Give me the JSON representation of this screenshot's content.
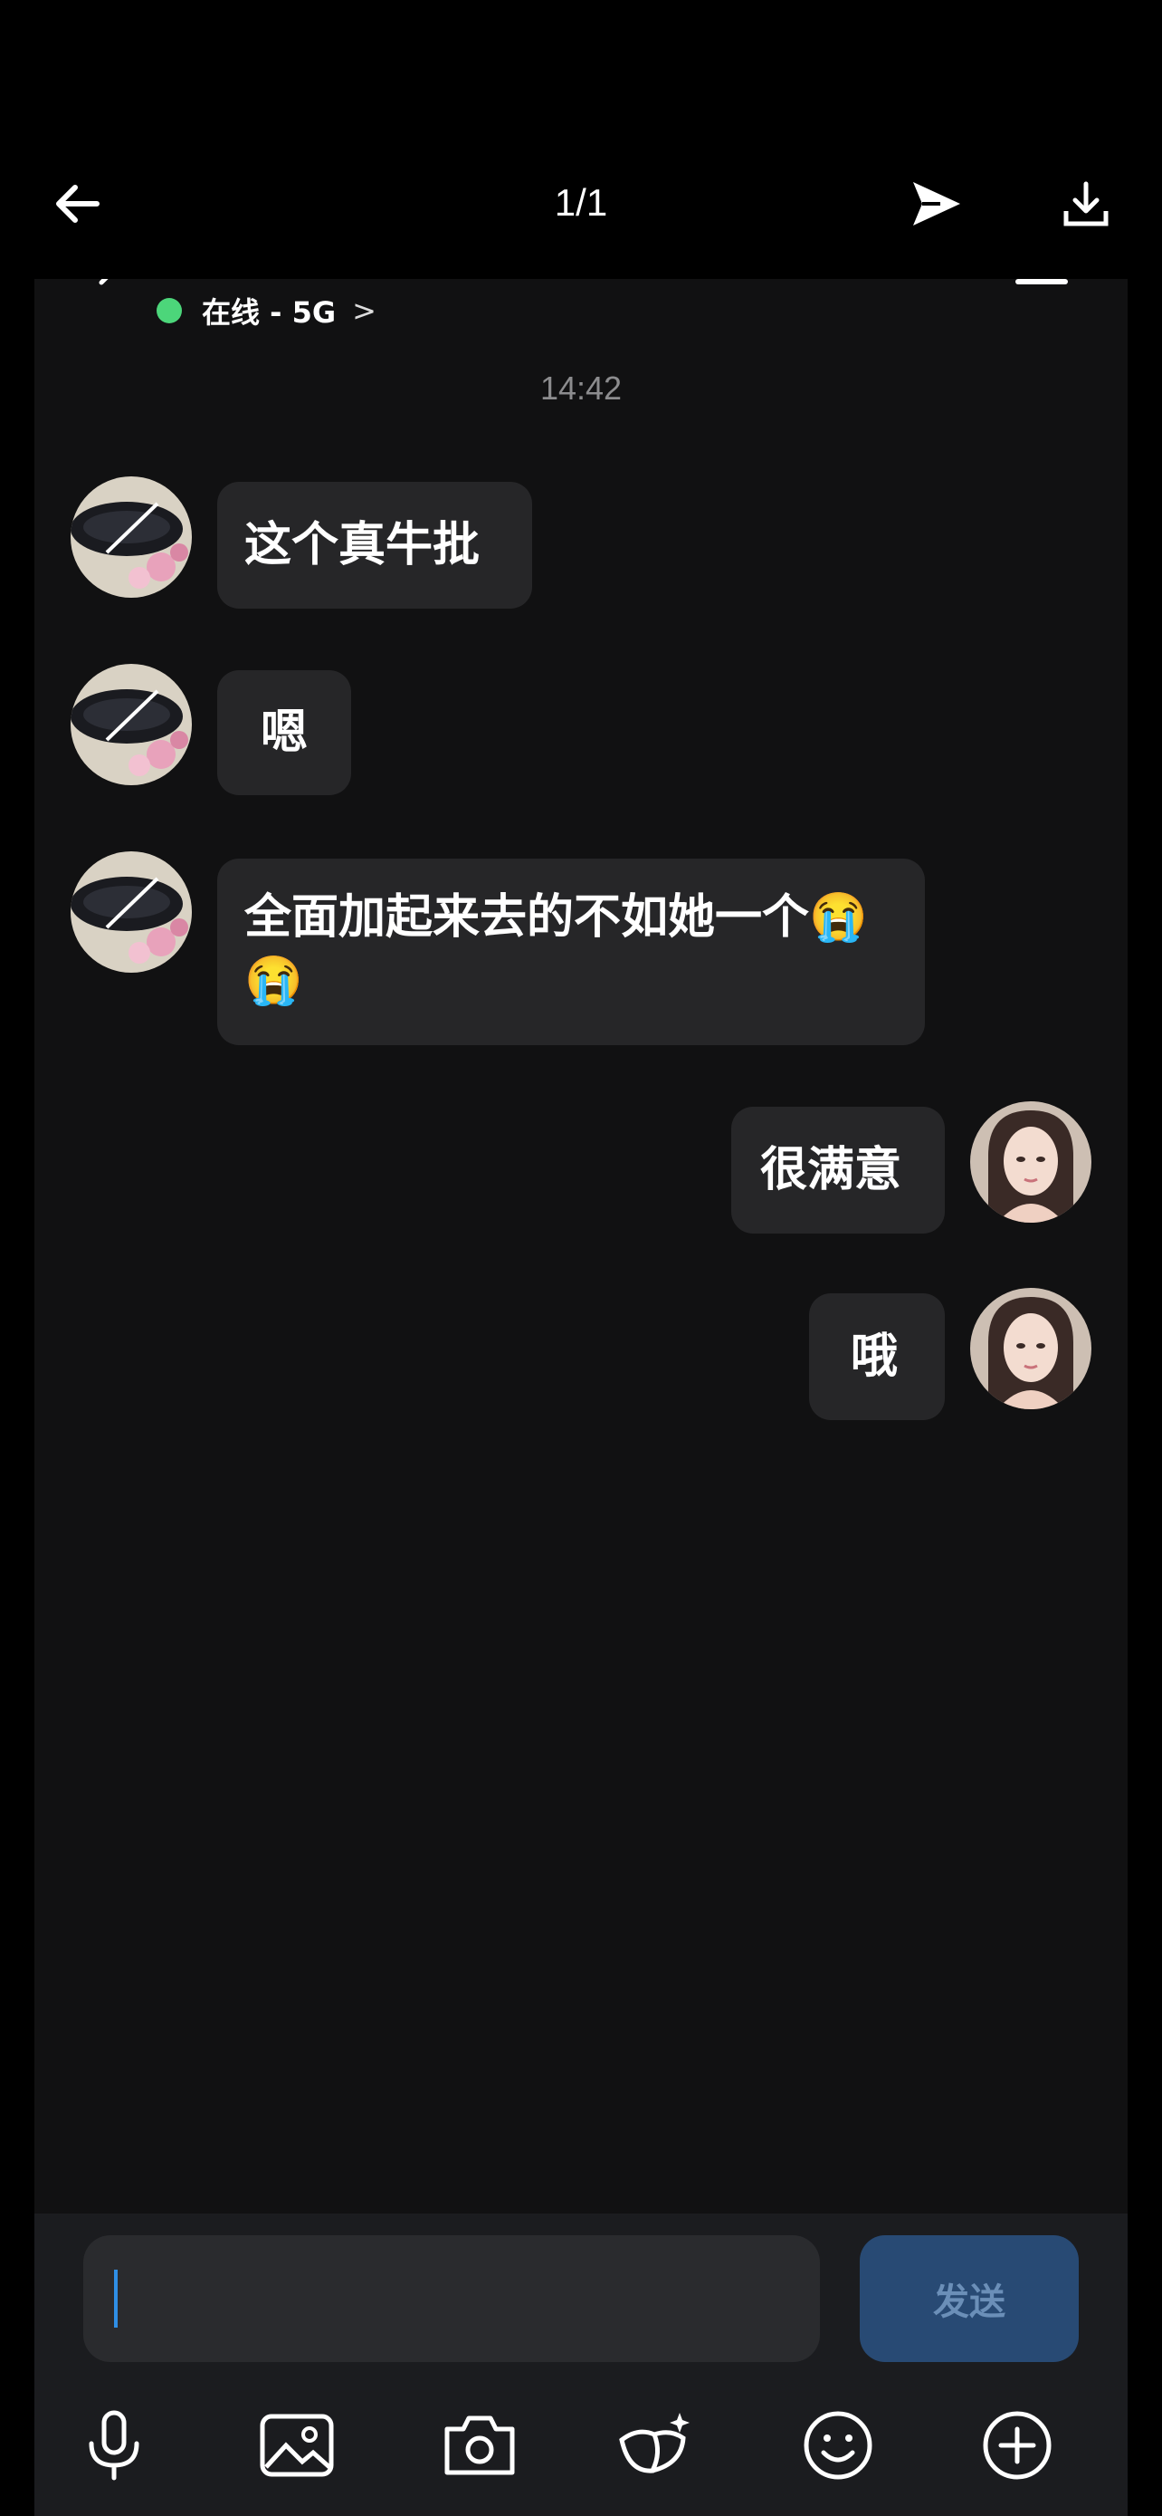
{
  "viewer": {
    "counter": "1/1",
    "icons": [
      "back-arrow-icon",
      "send-icon",
      "download-icon"
    ]
  },
  "chat": {
    "status": "在线 - 5G",
    "status_chevron": ">",
    "status_color": "#4cd67a",
    "timestamp": "14:42",
    "messages": [
      {
        "side": "left",
        "text": "这个真牛批"
      },
      {
        "side": "left",
        "text": "嗯"
      },
      {
        "side": "left",
        "text": "全面加起来去的不如她一个😭😭"
      },
      {
        "side": "right",
        "text": "很满意"
      },
      {
        "side": "right",
        "text": "哦"
      }
    ],
    "input": {
      "value": ""
    },
    "send_label": "发送",
    "toolbar": [
      "microphone-icon",
      "image-icon",
      "camera-icon",
      "mask-effect-icon",
      "emoji-icon",
      "plus-icon"
    ]
  },
  "colors": {
    "accent": "#2f8fe6",
    "send_button": "#284a74",
    "bubble": "#262628",
    "background": "#111112"
  }
}
